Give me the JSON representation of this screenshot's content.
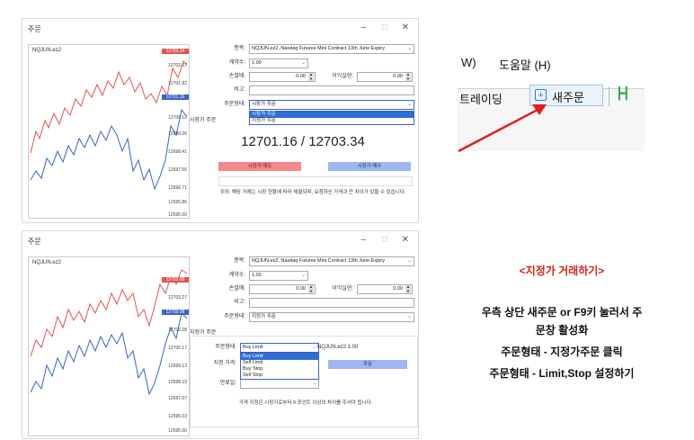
{
  "colors": {
    "sell": "#f4888a",
    "buy": "#9fb7ef",
    "red_line": "#e45151",
    "blue_line": "#3a62c9",
    "arrow": "#e02020",
    "heading": "#d9231c"
  },
  "window1": {
    "title": "주문",
    "controls": {
      "minimize": "–",
      "maximize": "□",
      "close": "✕"
    },
    "chart": {
      "symbol": "NQJUN.ez2",
      "price_labels": [
        "12702.67",
        "12701.82",
        "12700.12",
        "12699.26",
        "12698.41",
        "12697.56",
        "12696.71",
        "12695.86",
        "12695.00"
      ],
      "tag_red": "12703.34",
      "tag_blue": "12701.16"
    },
    "form": {
      "symbol_label": "종목:",
      "symbol_value": "NQJUN.ez2, Nasdaq Futures Mini Contract 13th June Expiry",
      "volume_label": "계약수:",
      "volume_value": "1.00",
      "sl_label": "손절매:",
      "sl_value": "0.00",
      "tp_label": "이익실현:",
      "tp_value": "0.00",
      "comment_label": "비고:",
      "comment_value": "",
      "type_label": "주문형태:",
      "type_value": "시장가 주문",
      "type_options": [
        "시장가 주문",
        "지정가 주문"
      ],
      "market_label": "시장가 주문",
      "prices": "12701.16 / 12703.34",
      "sell_button": "시장가 매도",
      "buy_button": "시장가 매수",
      "note": "주의: 해당 거래는 시장 현황에 따라 체결되며, 요청하신 가격과 큰 차이가 있을 수 있습니다."
    }
  },
  "window2": {
    "title": "주문",
    "controls": {
      "minimize": "–",
      "maximize": "□",
      "close": "✕"
    },
    "chart": {
      "symbol": "NQJUN.ez2",
      "price_labels": [
        "12703.27",
        "12702.28",
        "12700.17",
        "12699.13",
        "12698.19",
        "12697.07",
        "12696.03",
        "12695.00"
      ],
      "tag_red": "12702.69",
      "tag_blue": "12700.98"
    },
    "form": {
      "symbol_label": "종목:",
      "symbol_value": "NQJUN.ez2, Nasdaq Futures Mini Contract 13th June Expiry",
      "volume_label": "계약수:",
      "volume_value": "1.00",
      "sl_label": "손절매:",
      "sl_value": "0.00",
      "tp_label": "이익실현:",
      "tp_value": "0.00",
      "comment_label": "비고:",
      "comment_value": "",
      "type_label": "주문형태:",
      "type_value": "지정가 주문",
      "pending_label": "지정가 주문",
      "ptype_label": "주문형태:",
      "ptype_value": "Buy Limit",
      "ptype_options": [
        "Buy Limit",
        "Sell Limit",
        "Buy Stop",
        "Sell Stop"
      ],
      "ptype_info": "NQJUN.ez2 1.00",
      "price_label": "지정 가격:",
      "place_button": "주문",
      "expiry_label": "만료일:",
      "note": "가격 지정은 시장가로부터 0 포인트 이상의 차이를 주셔야 됩니다."
    }
  },
  "crop": {
    "menu_partial": "W)",
    "menu_help": "도움말 (H)",
    "toolbar_trading": "트레이딩",
    "new_order_icon": "plus-square-icon",
    "new_order_label": "새주문",
    "chart_icon": "candlestick-icon"
  },
  "guide": {
    "heading": "<지정가 거래하기>",
    "line1": "우측 상단 새주문 or F9키 눌러서 주",
    "line2": "문창 활성화",
    "line3": "주문형태 - 지정가주문 클릭",
    "line4": "주문형태 - Limit,Stop 설정하기"
  }
}
